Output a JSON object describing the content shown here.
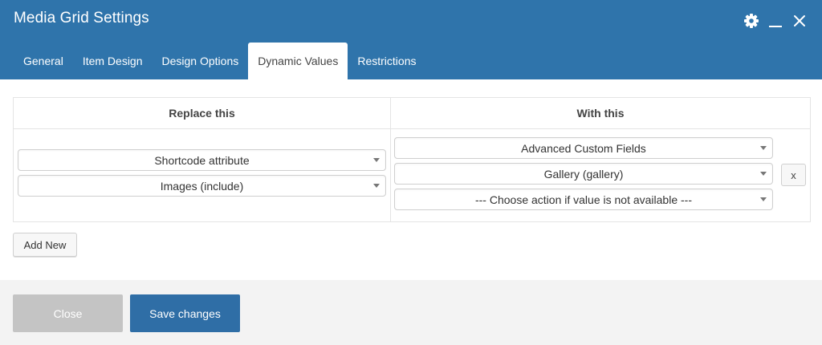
{
  "window": {
    "title": "Media Grid Settings",
    "controls": [
      "gear-icon",
      "minimize-icon",
      "close-icon"
    ]
  },
  "tabs": [
    {
      "label": "General",
      "active": false
    },
    {
      "label": "Item Design",
      "active": false
    },
    {
      "label": "Design Options",
      "active": false
    },
    {
      "label": "Dynamic Values",
      "active": true
    },
    {
      "label": "Restrictions",
      "active": false
    }
  ],
  "table": {
    "headers": {
      "replace": "Replace this",
      "with": "With this"
    },
    "replace_selects": [
      {
        "value": "Shortcode attribute"
      },
      {
        "value": "Images (include)"
      }
    ],
    "with_selects": [
      {
        "value": "Advanced Custom Fields"
      },
      {
        "value": "Gallery (gallery)"
      },
      {
        "value": "--- Choose action if value is not available ---"
      }
    ],
    "remove_label": "x"
  },
  "add_new_label": "Add New",
  "footer": {
    "close_label": "Close",
    "save_label": "Save changes"
  },
  "colors": {
    "header": "#2f74ab",
    "save_button": "#2f6ea6",
    "close_button": "#c4c4c4",
    "footer_bg": "#f3f3f3"
  }
}
